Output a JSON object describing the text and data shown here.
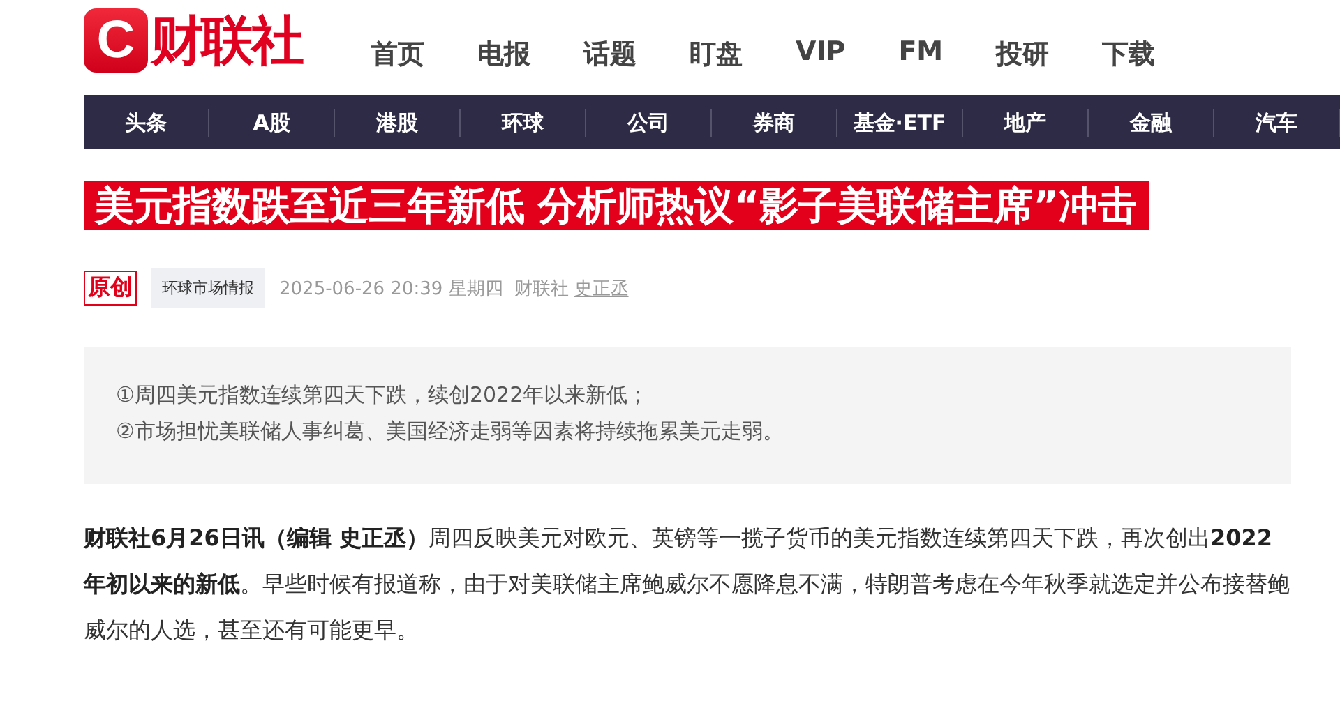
{
  "logo": {
    "mark": "C",
    "name": "财联社"
  },
  "top_nav": [
    {
      "label": "首页"
    },
    {
      "label": "电报"
    },
    {
      "label": "话题"
    },
    {
      "label": "盯盘"
    },
    {
      "label": "VIP"
    },
    {
      "label": "FM"
    },
    {
      "label": "投研"
    },
    {
      "label": "下载"
    }
  ],
  "channel_nav": [
    {
      "label": "头条"
    },
    {
      "label": "A股"
    },
    {
      "label": "港股"
    },
    {
      "label": "环球"
    },
    {
      "label": "公司"
    },
    {
      "label": "券商"
    },
    {
      "label": "基金·ETF"
    },
    {
      "label": "地产"
    },
    {
      "label": "金融"
    },
    {
      "label": "汽车"
    }
  ],
  "article": {
    "headline": "美元指数跌至近三年新低 分析师热议“影子美联储主席”冲击",
    "badge": "原创",
    "tag": "环球市场情报",
    "datetime": "2025-06-26 20:39 星期四",
    "source": "财联社",
    "author": "史正丞",
    "summary": [
      "①周四美元指数连续第四天下跌，续创2022年以来新低；",
      "②市场担忧美联储人事纠葛、美国经济走弱等因素将持续拖累美元走弱。"
    ],
    "body": "**财联社6月26日讯（编辑 史正丞）**周四反映美元对欧元、英镑等一揽子货币的美元指数连续第四天下跌，再次创出**2022年初以来的新低**。早些时候有报道称，由于对美联储主席鲍威尔不愿降息不满，特朗普考虑在今年秋季就选定并公布接替鲍威尔的人选，甚至还有可能更早。"
  }
}
